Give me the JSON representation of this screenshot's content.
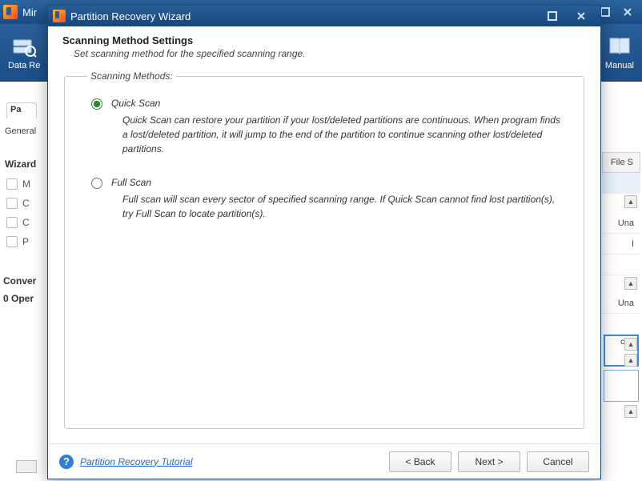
{
  "outer_window": {
    "title": "Mir"
  },
  "toolbar": {
    "left_label": "Data Re",
    "right_label": "Manual"
  },
  "background_panels": {
    "active_tab": "Pa",
    "general": "General",
    "wizards_header": "Wizard",
    "wizard_items": [
      "M",
      "C",
      "C",
      "P"
    ],
    "convert_header": "Conver",
    "operations": "0 Oper",
    "right_header": "File S",
    "right_cells": [
      "",
      "Una",
      "I",
      "",
      "Una"
    ],
    "stripcard": "cate"
  },
  "modal": {
    "title": "Partition Recovery Wizard",
    "heading": "Scanning Method Settings",
    "subheading": "Set scanning method for the specified scanning range.",
    "legend": "Scanning Methods:",
    "options": {
      "quick": {
        "label": "Quick Scan",
        "desc": "Quick Scan can restore your partition if your lost/deleted partitions are continuous. When program finds a lost/deleted partition, it will jump to the end of the partition to continue scanning other lost/deleted partitions.",
        "selected": true
      },
      "full": {
        "label": "Full Scan",
        "desc": "Full scan will scan every sector of specified scanning range. If Quick Scan cannot find lost partition(s), try Full Scan to locate partition(s).",
        "selected": false
      }
    },
    "help_link": "Partition Recovery Tutorial",
    "buttons": {
      "back": "< Back",
      "next": "Next >",
      "cancel": "Cancel"
    }
  }
}
